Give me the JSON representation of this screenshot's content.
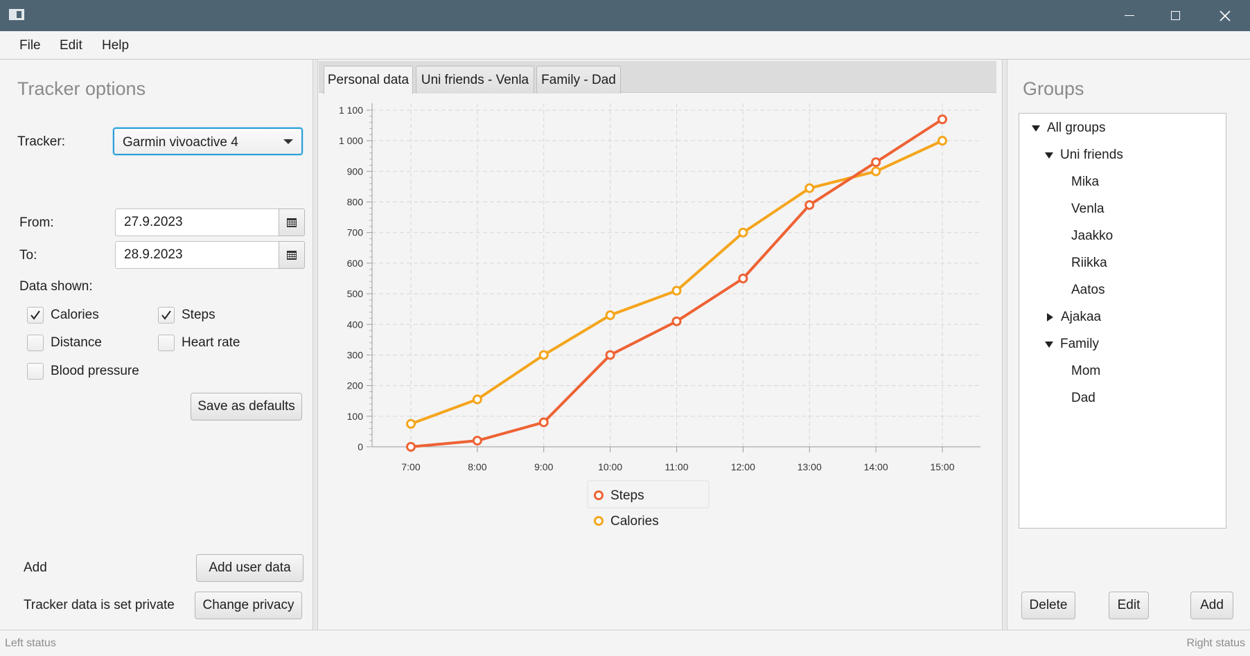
{
  "window": {
    "icons": {
      "app": "app-window-icon",
      "minimize": "minimize-icon",
      "maximize": "maximize-icon",
      "close": "close-icon"
    }
  },
  "menu": {
    "file": "File",
    "edit": "Edit",
    "help": "Help"
  },
  "left_panel": {
    "title": "Tracker options",
    "tracker_label": "Tracker:",
    "tracker_value": "Garmin vivoactive 4",
    "from_label": "From:",
    "from_value": "27.9.2023",
    "to_label": "To:",
    "to_value": "28.9.2023",
    "data_shown_label": "Data shown:",
    "checkboxes": [
      {
        "label": "Calories",
        "checked": true
      },
      {
        "label": "Steps",
        "checked": true
      },
      {
        "label": "Distance",
        "checked": false
      },
      {
        "label": "Heart rate",
        "checked": false
      },
      {
        "label": "Blood pressure",
        "checked": false
      }
    ],
    "save_defaults": "Save as defaults",
    "add_label": "Add",
    "add_user_data": "Add user data",
    "privacy_text": "Tracker data is set private",
    "change_privacy": "Change privacy"
  },
  "tabs": [
    {
      "label": "Personal data",
      "active": true
    },
    {
      "label": "Uni friends - Venla",
      "active": false
    },
    {
      "label": "Family - Dad",
      "active": false
    }
  ],
  "chart_data": {
    "type": "line",
    "categories": [
      "7:00",
      "8:00",
      "9:00",
      "10:00",
      "11:00",
      "12:00",
      "13:00",
      "14:00",
      "15:00"
    ],
    "y_tick_labels": [
      "0",
      "100",
      "200",
      "300",
      "400",
      "500",
      "600",
      "700",
      "800",
      "900",
      "1 000",
      "1 100"
    ],
    "ylim": [
      0,
      1100
    ],
    "grid": true,
    "legend_position": "bottom",
    "series": [
      {
        "name": "Steps",
        "color": "#ee6234",
        "values": [
          0,
          20,
          80,
          300,
          410,
          550,
          790,
          930,
          1070
        ]
      },
      {
        "name": "Calories",
        "color": "#f4a51c",
        "values": [
          75,
          155,
          300,
          430,
          510,
          700,
          845,
          900,
          1000
        ]
      }
    ]
  },
  "right_panel": {
    "title": "Groups",
    "tree": [
      {
        "label": "All groups",
        "level": 0,
        "expander": "expanded"
      },
      {
        "label": "Uni friends",
        "level": 1,
        "expander": "expanded"
      },
      {
        "label": "Mika",
        "level": 2,
        "expander": "none"
      },
      {
        "label": "Venla",
        "level": 2,
        "expander": "none"
      },
      {
        "label": "Jaakko",
        "level": 2,
        "expander": "none"
      },
      {
        "label": "Riikka",
        "level": 2,
        "expander": "none"
      },
      {
        "label": "Aatos",
        "level": 2,
        "expander": "none"
      },
      {
        "label": "Ajakaa",
        "level": 1,
        "expander": "collapsed"
      },
      {
        "label": "Family",
        "level": 1,
        "expander": "expanded"
      },
      {
        "label": "Mom",
        "level": 2,
        "expander": "none"
      },
      {
        "label": "Dad",
        "level": 2,
        "expander": "none"
      }
    ],
    "delete": "Delete",
    "edit": "Edit",
    "add": "Add"
  },
  "status": {
    "left": "Left status",
    "right": "Right status"
  }
}
